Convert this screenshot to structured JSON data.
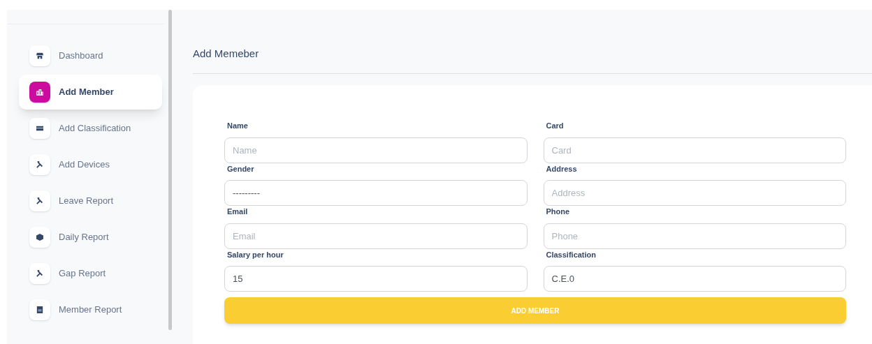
{
  "sidebar": {
    "items": [
      {
        "label": "Dashboard",
        "selected": false
      },
      {
        "label": "Add Member",
        "selected": true
      },
      {
        "label": "Add Classification",
        "selected": false
      },
      {
        "label": "Add Devices",
        "selected": false
      },
      {
        "label": "Leave Report",
        "selected": false
      },
      {
        "label": "Daily Report",
        "selected": false
      },
      {
        "label": "Gap Report",
        "selected": false
      },
      {
        "label": "Member Report",
        "selected": false
      }
    ]
  },
  "page_title": "Add Memeber",
  "form": {
    "fields": [
      {
        "label": "Name",
        "placeholder": "Name"
      },
      {
        "label": "Card",
        "placeholder": "Card"
      },
      {
        "label": "Gender",
        "value": "---------"
      },
      {
        "label": "Address",
        "placeholder": "Address"
      },
      {
        "label": "Email",
        "placeholder": "Email"
      },
      {
        "label": "Phone",
        "placeholder": "Phone"
      },
      {
        "label": "Salary per hour",
        "value": "15"
      },
      {
        "label": "Classification",
        "value": "C.E.0"
      }
    ],
    "submit": "ADD MEMBER"
  }
}
